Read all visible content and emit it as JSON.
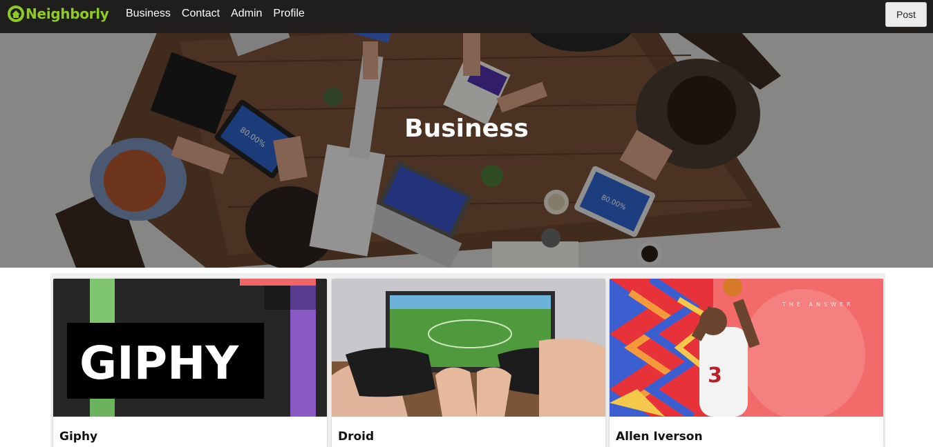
{
  "brand": {
    "name": "Neighborly",
    "color": "#8ecb24"
  },
  "nav": {
    "links": [
      "Business",
      "Contact",
      "Admin",
      "Profile"
    ],
    "post_label": "Post"
  },
  "hero": {
    "title": "Business"
  },
  "cards": [
    {
      "title": "Giphy",
      "image_text": "GIPHY"
    },
    {
      "title": "Droid"
    },
    {
      "title": "Allen Iverson",
      "image_text": "THE ANSWER",
      "jersey_number": "3"
    }
  ],
  "hero_screens": {
    "tablet_left": "80.00%",
    "tablet_right": "80.00%"
  }
}
